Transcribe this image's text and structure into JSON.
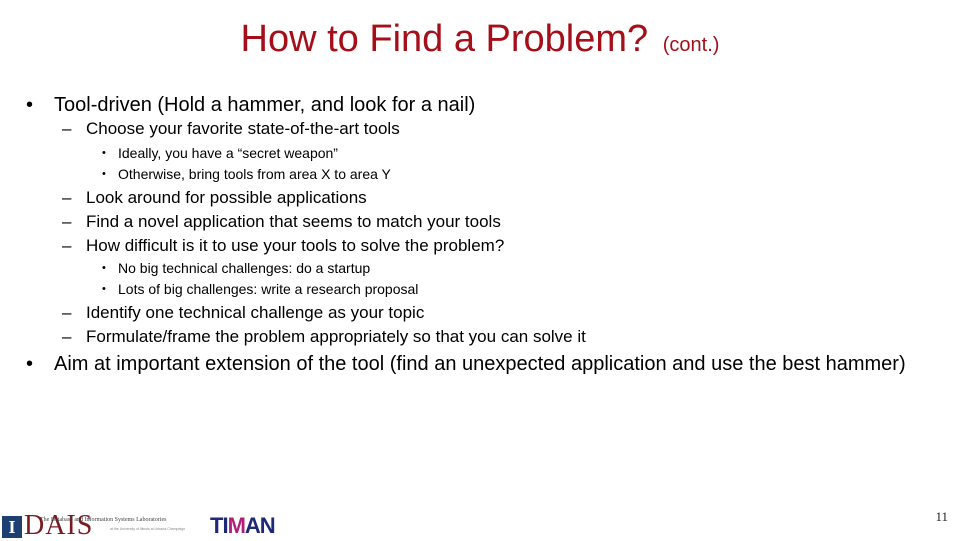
{
  "slide": {
    "title": "How to Find a Problem?",
    "title_suffix": "(cont.)",
    "colors": {
      "title": "#a50f1a",
      "text": "#000000"
    },
    "bullets": [
      {
        "text": "Tool-driven (Hold a hammer, and look for a nail)",
        "children": [
          {
            "text": "Choose your favorite state-of-the-art tools",
            "children": [
              {
                "text": "Ideally, you have a “secret weapon”"
              },
              {
                "text": "Otherwise, bring tools from area X to area Y"
              }
            ]
          },
          {
            "text": "Look around for possible applications"
          },
          {
            "text": "Find a novel application that seems to match your tools"
          },
          {
            "text": "How difficult is it to use your tools to solve the problem?",
            "children": [
              {
                "text": "No big technical challenges: do a startup"
              },
              {
                "text": "Lots of big challenges: write a research proposal"
              }
            ]
          },
          {
            "text": "Identify one technical challenge as your topic"
          },
          {
            "text": "Formulate/frame the problem appropriately so that you can solve it"
          }
        ]
      },
      {
        "text": "Aim at important extension of the tool (find an unexpected application and use the best hammer)"
      }
    ],
    "bullet_glyphs": {
      "level1": "•",
      "level2": "–",
      "level3": "•"
    },
    "page_number": "11"
  },
  "footer": {
    "illinois_logo": "I",
    "dais_logo": "DAIS",
    "dais_subtitle": "The Database and Information Systems Laboratories",
    "dais_subtitle_2": "at the University of Illinois at Urbana-Champaign",
    "timan_logo_pre": "TI",
    "timan_logo_m": "M",
    "timan_logo_post": "AN"
  }
}
